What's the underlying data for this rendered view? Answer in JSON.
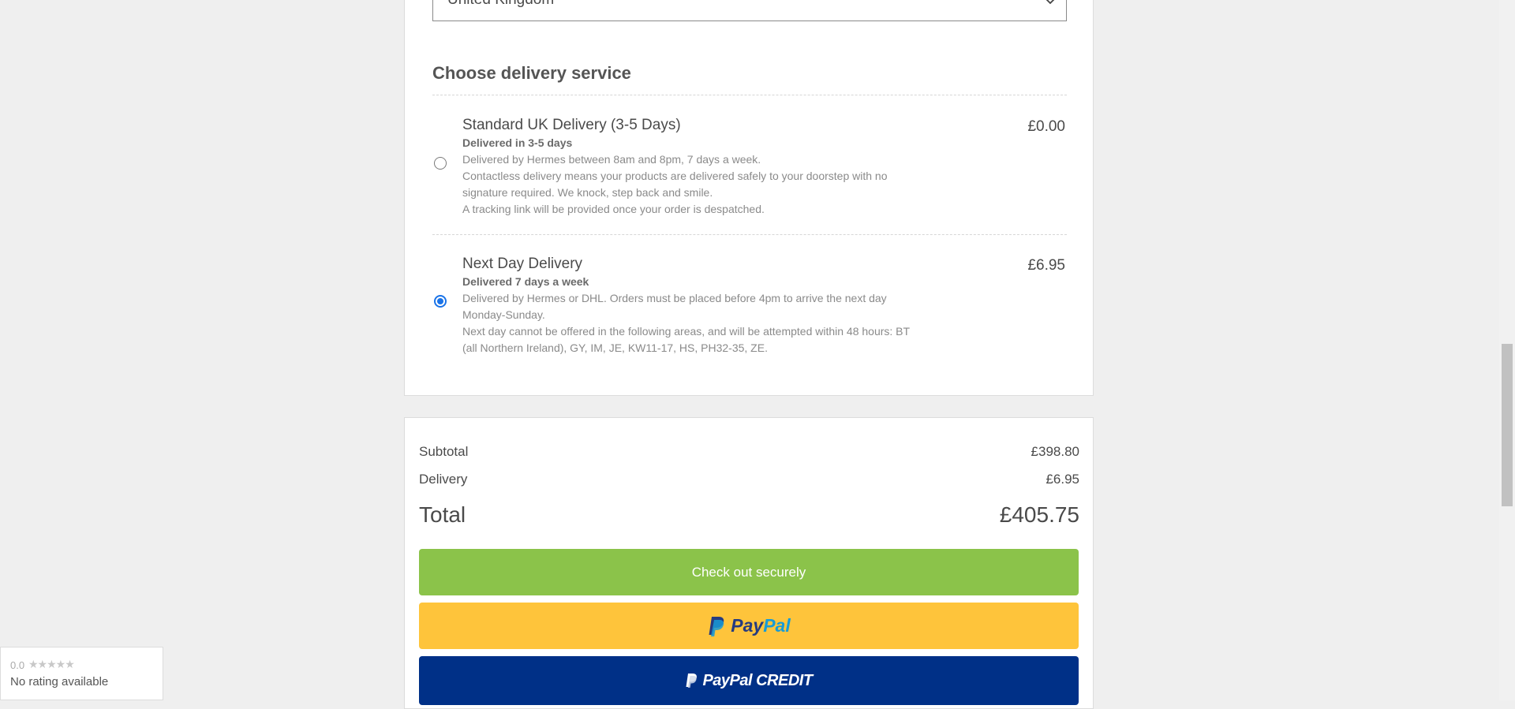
{
  "address": {
    "country_value": "United Kingdom"
  },
  "delivery": {
    "title": "Choose delivery service",
    "options": [
      {
        "name": "Standard UK Delivery (3-5 Days)",
        "subtitle": "Delivered in 3-5 days",
        "lines": [
          "Delivered by Hermes between 8am and 8pm, 7 days a week.",
          "Contactless delivery means your products are delivered safely to your doorstep with no",
          "signature required. We knock, step back and smile.",
          "A tracking link will be provided once your order is despatched."
        ],
        "price": "£0.00",
        "selected": false
      },
      {
        "name": "Next Day Delivery",
        "subtitle": "Delivered 7 days a week",
        "lines": [
          "Delivered by Hermes or DHL. Orders must be placed before 4pm to arrive the next day",
          "Monday-Sunday.",
          "Next day cannot be offered in the following areas, and will be attempted within 48 hours: BT",
          "(all Northern Ireland), GY, IM, JE, KW11-17, HS, PH32-35, ZE."
        ],
        "price": "£6.95",
        "selected": true
      }
    ]
  },
  "summary": {
    "subtotal_label": "Subtotal",
    "subtotal_value": "£398.80",
    "delivery_label": "Delivery",
    "delivery_value": "£6.95",
    "total_label": "Total",
    "total_value": "£405.75",
    "checkout_label": "Check out securely",
    "paypal_a": "Pay",
    "paypal_b": "Pal",
    "paypal_credit_label": "PayPal CREDIT"
  },
  "rating": {
    "score": "0.0",
    "stars": "★★★★★",
    "text": "No rating available"
  },
  "colors": {
    "checkout": "#8bc34a",
    "paypal": "#fec43b",
    "paypal_credit": "#003087",
    "radio_selected": "#1a73e8"
  },
  "icons": [
    "chevron-down-icon",
    "paypal-logo-icon",
    "paypal-credit-logo-icon",
    "star-icon"
  ]
}
